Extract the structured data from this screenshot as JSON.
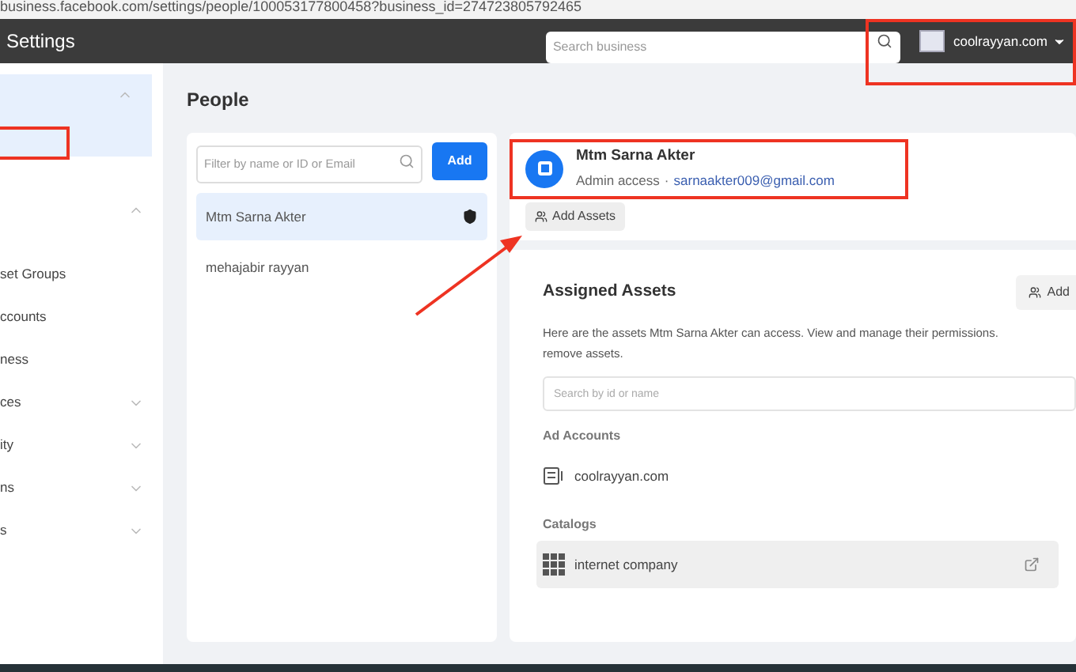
{
  "browser": {
    "url": "business.facebook.com/settings/people/100053177800458?business_id=274723805792465"
  },
  "header": {
    "title": "Settings",
    "search": {
      "placeholder": "Search business"
    },
    "account": {
      "name": "coolrayyan.com"
    }
  },
  "sidebar": {
    "items": [
      {
        "kind": "section",
        "expanded": true,
        "selected": true
      },
      {
        "kind": "section",
        "expanded": true,
        "selected": false
      },
      {
        "label": "set Groups",
        "kind": "link",
        "selected": false
      },
      {
        "label": "ccounts",
        "kind": "link",
        "selected": false
      },
      {
        "label": "ness",
        "kind": "link",
        "selected": false
      },
      {
        "label": "ces",
        "kind": "section",
        "expanded": false,
        "selected": false
      },
      {
        "label": "ity",
        "kind": "section",
        "expanded": false,
        "selected": false
      },
      {
        "label": "ns",
        "kind": "section",
        "expanded": false,
        "selected": false
      },
      {
        "label": "s",
        "kind": "section",
        "expanded": false,
        "selected": false
      }
    ]
  },
  "page": {
    "title": "People"
  },
  "people": {
    "filter": {
      "placeholder": "Filter by name or ID or Email"
    },
    "add_button": "Add",
    "items": [
      {
        "name": "Mtm Sarna Akter",
        "selected": true,
        "admin": true
      },
      {
        "name": "mehajabir rayyan",
        "selected": false,
        "admin": false
      }
    ]
  },
  "person": {
    "name": "Mtm Sarna Akter",
    "access": "Admin access",
    "separator": "·",
    "email": "sarnaakter009@gmail.com",
    "add_assets_button": "Add Assets"
  },
  "assigned": {
    "title": "Assigned Assets",
    "add_button": "Add",
    "description": "Here are the assets Mtm Sarna Akter can access. View and manage their permissions.",
    "description_2": "remove assets.",
    "search": {
      "placeholder": "Search by id or name"
    },
    "groups": [
      {
        "title": "Ad Accounts",
        "items": [
          {
            "name": "coolrayyan.com",
            "kind": "ad-account",
            "selected": false
          }
        ]
      },
      {
        "title": "Catalogs",
        "items": [
          {
            "name": "internet company",
            "kind": "catalog",
            "selected": true
          }
        ]
      }
    ]
  }
}
